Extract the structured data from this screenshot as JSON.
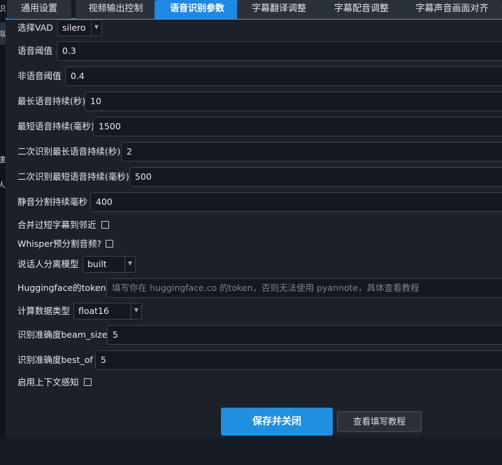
{
  "tabs": [
    {
      "label": "通用设置"
    },
    {
      "label": "视频输出控制"
    },
    {
      "label": "语音识别参数",
      "active": true
    },
    {
      "label": "字幕翻译调整"
    },
    {
      "label": "字幕配音调整"
    },
    {
      "label": "字幕声音画面对齐"
    }
  ],
  "background_window_fragments": [
    "识",
    "拟",
    "速",
    "人"
  ],
  "form": {
    "vad": {
      "label": "选择VAD",
      "value": "silero"
    },
    "speech_threshold": {
      "label": "语音阈值",
      "value": "0.3"
    },
    "nonspeech_threshold": {
      "label": "非语音阈值",
      "value": "0.4"
    },
    "max_speech_duration": {
      "label": "最长语音持续(秒)",
      "value": "10"
    },
    "min_speech_duration": {
      "label": "最短语音持续(毫秒)",
      "value": "1500"
    },
    "second_max_speech": {
      "label": "二次识别最长语音持续(秒)",
      "value": "2"
    },
    "second_min_speech": {
      "label": "二次识别最短语音持续(毫秒)",
      "value": "500"
    },
    "silence_split": {
      "label": "静音分割持续毫秒",
      "value": "400"
    },
    "merge_short": {
      "label": "合并过短字幕到邻近",
      "checked": false
    },
    "whisper_presplit": {
      "label": "Whisper预分割音频?",
      "checked": false
    },
    "speaker_model": {
      "label": "说话人分离模型",
      "value": "built"
    },
    "hf_token": {
      "label": "Huggingface的token",
      "value": "",
      "placeholder": "填写你在 huggingface.co 的token，否则无法使用 pyannote，具体查看教程"
    },
    "compute_type": {
      "label": "计算数据类型",
      "value": "float16"
    },
    "beam_size": {
      "label": "识别准确度beam_size",
      "value": "5"
    },
    "best_of": {
      "label": "识别准确度best_of",
      "value": "5"
    },
    "context_aware": {
      "label": "启用上下文感知",
      "checked": false
    }
  },
  "buttons": {
    "save": "保存并关闭",
    "help": "查看填写教程"
  },
  "colors": {
    "accent": "#1e88e5",
    "save_button": "#1f8fe0",
    "panel": "#1c2129",
    "input_bg": "#141920"
  }
}
